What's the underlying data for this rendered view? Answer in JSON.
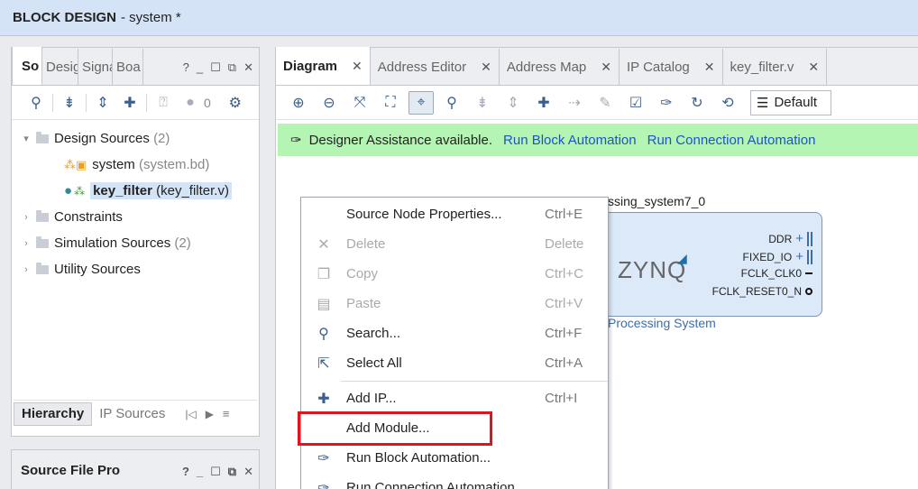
{
  "window": {
    "title_bold": "BLOCK DESIGN",
    "title_rest": "- system *"
  },
  "sources_panel": {
    "tabs": [
      "So",
      "Desig",
      "Signa",
      "Boa"
    ],
    "toolbar_badge": "0",
    "tree": [
      {
        "label": "Design Sources",
        "count": "(2)"
      },
      {
        "label": "system",
        "detail": "(system.bd)"
      },
      {
        "label": "key_filter",
        "detail": "(key_filter.v)"
      },
      {
        "label": "Constraints"
      },
      {
        "label": "Simulation Sources",
        "count": "(2)"
      },
      {
        "label": "Utility Sources"
      }
    ],
    "bottom_tabs": [
      "Hierarchy",
      "IP Sources"
    ]
  },
  "properties_panel": {
    "title": "Source File Pro"
  },
  "diagram_panel": {
    "tabs": [
      "Diagram",
      "Address Editor",
      "Address Map",
      "IP Catalog",
      "key_filter.v"
    ],
    "view_select": "Default",
    "assist": {
      "text": "Designer Assistance available.",
      "link1": "Run Block Automation",
      "link2": "Run Connection Automation"
    },
    "block": {
      "name": "ssing_system7_0",
      "logo": "ZYNQ",
      "subtitle": "Processing System",
      "ports": [
        "DDR",
        "FIXED_IO",
        "FCLK_CLK0",
        "FCLK_RESET0_N"
      ]
    }
  },
  "context_menu": {
    "items": [
      {
        "label": "Source Node Properties...",
        "shortcut": "Ctrl+E",
        "icon": "none",
        "enabled": true
      },
      {
        "label": "Delete",
        "shortcut": "Delete",
        "icon": "close-icon",
        "enabled": false
      },
      {
        "label": "Copy",
        "shortcut": "Ctrl+C",
        "icon": "copy-icon",
        "enabled": false
      },
      {
        "label": "Paste",
        "shortcut": "Ctrl+V",
        "icon": "paste-icon",
        "enabled": false
      },
      {
        "label": "Search...",
        "shortcut": "Ctrl+F",
        "icon": "search-icon",
        "enabled": true
      },
      {
        "label": "Select All",
        "shortcut": "Ctrl+A",
        "icon": "select-all-icon",
        "enabled": true
      },
      {
        "label": "Add IP...",
        "shortcut": "Ctrl+I",
        "icon": "plus-icon",
        "enabled": true
      },
      {
        "label": "Add Module...",
        "shortcut": "",
        "icon": "none",
        "enabled": true
      },
      {
        "label": "Run Block Automation...",
        "shortcut": "",
        "icon": "wand-icon",
        "enabled": true
      },
      {
        "label": "Run Connection Automation",
        "shortcut": "",
        "icon": "wand-icon",
        "enabled": true
      }
    ]
  },
  "colors": {
    "assist_bg": "#b4f5b4",
    "highlight": "#e0141e",
    "title_bg": "#d5e3f7",
    "link": "#1b55c6"
  }
}
